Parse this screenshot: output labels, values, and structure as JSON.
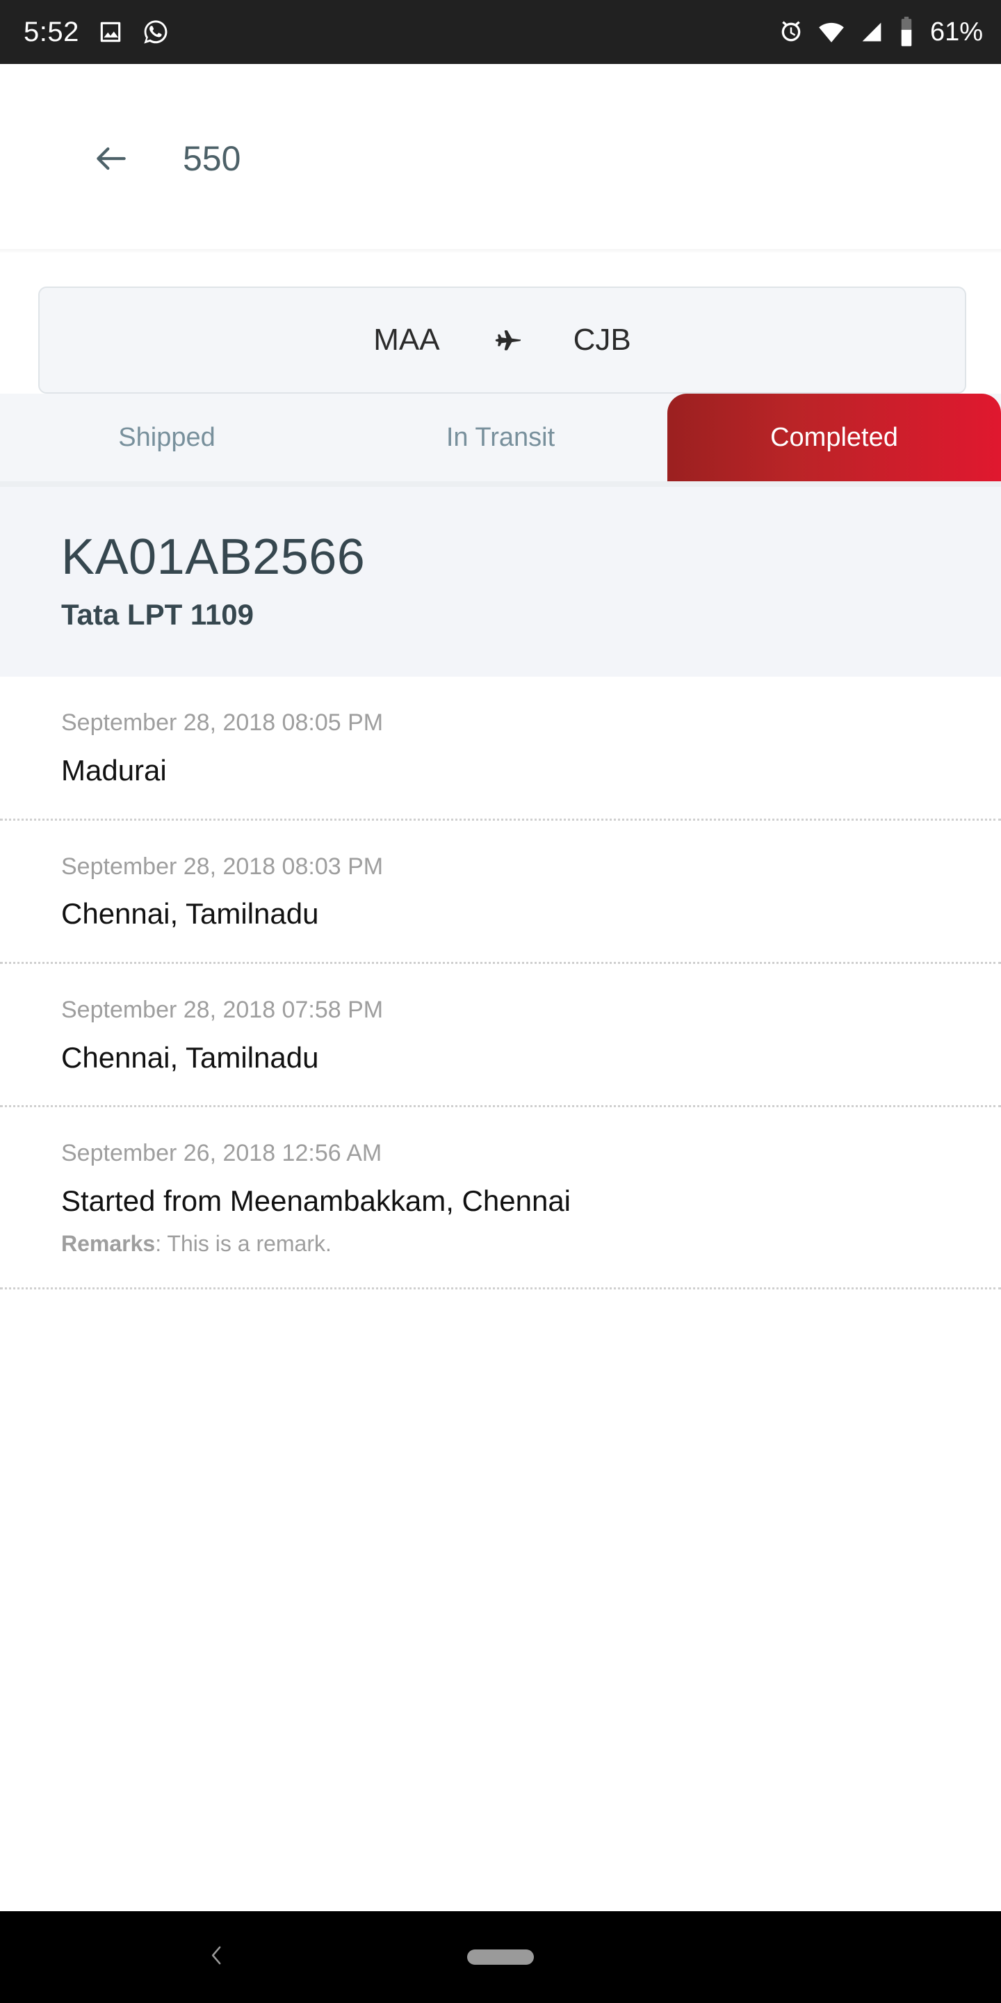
{
  "status_bar": {
    "time": "5:52",
    "battery_text": "61%",
    "left_icons": [
      "gallery-icon",
      "whatsapp-icon"
    ],
    "right_icons": [
      "alarm-icon",
      "wifi-icon",
      "signal-icon",
      "battery-icon"
    ]
  },
  "app_bar": {
    "back_icon": "back-arrow-icon",
    "title": "550"
  },
  "route": {
    "origin": "MAA",
    "destination": "CJB",
    "mode_icon": "airplane-icon"
  },
  "tabs": [
    {
      "label": "Shipped",
      "active": false
    },
    {
      "label": "In Transit",
      "active": false
    },
    {
      "label": "Completed",
      "active": true
    }
  ],
  "vehicle": {
    "plate": "KA01AB2566",
    "model": "Tata LPT 1109"
  },
  "timeline": [
    {
      "time": "September 28, 2018 08:05 PM",
      "location": "Madurai",
      "remarks_label": "",
      "remarks_value": ""
    },
    {
      "time": "September 28, 2018 08:03 PM",
      "location": "Chennai, Tamilnadu",
      "remarks_label": "",
      "remarks_value": ""
    },
    {
      "time": "September 28, 2018 07:58 PM",
      "location": "Chennai, Tamilnadu",
      "remarks_label": "",
      "remarks_value": ""
    },
    {
      "time": "September 26, 2018 12:56 AM",
      "location": "Started from Meenambakkam, Chennai",
      "remarks_label": "Remarks",
      "remarks_value": ": This is a remark."
    }
  ],
  "nav_bar": {
    "back_icon": "nav-back-chevron-icon",
    "home_icon": "nav-home-pill-icon"
  },
  "colors": {
    "status_bar_bg": "#212121",
    "accent_red_dark": "#9b2020",
    "accent_red_bright": "#e0182f",
    "title_slate": "#4d6168",
    "tab_inactive": "#78909c",
    "panel_bg": "#f3f5f9",
    "muted_text": "#9e9e9e"
  }
}
